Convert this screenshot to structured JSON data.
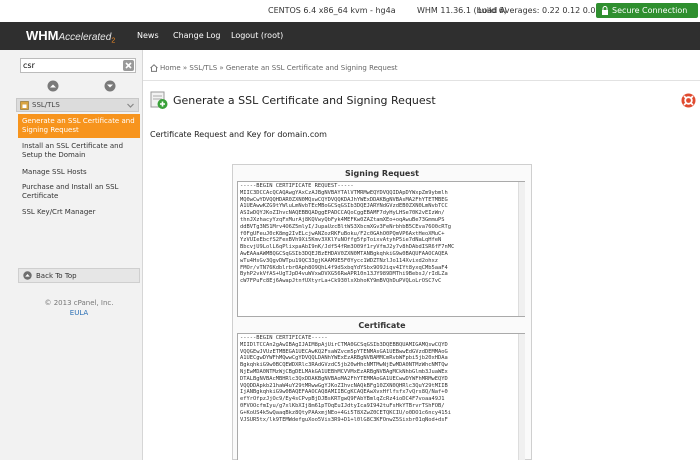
{
  "status": {
    "os": "CENTOS 6.4 x86_64 kvm - hg4a",
    "version": "WHM 11.36.1 (build 6)",
    "load": "Load Averages: 0.22 0.12 0.03",
    "secure": "Secure Connection"
  },
  "logo": {
    "primary": "WHM",
    "secondary": "Accelerated",
    "suffix": "2"
  },
  "nav": {
    "news": "News",
    "changelog": "Change Log",
    "logout": "Logout (root)"
  },
  "sidebar": {
    "search_value": "csr",
    "section": "SSL/TLS",
    "items": [
      {
        "label": "Generate an SSL Certificate and Signing Request",
        "active": true
      },
      {
        "label": "Install an SSL Certificate and Setup the Domain",
        "active": false
      },
      {
        "label": "Manage SSL Hosts",
        "active": false
      },
      {
        "label": "Purchase and Install an SSL Certificate",
        "active": false
      },
      {
        "label": "SSL Key/Crt Manager",
        "active": false
      }
    ],
    "back_to_top": "Back To Top",
    "copyright": "© 2013 cPanel, Inc.",
    "eula": "EULA"
  },
  "breadcrumb": "Home » SSL/TLS » Generate an SSL Certificate and Signing Request",
  "main": {
    "title": "Generate a SSL Certificate and Signing Request",
    "subtitle": "Certificate Request and Key for domain.com",
    "csr_heading": "Signing Request",
    "cert_heading": "Certificate",
    "csr_text": "-----BEGIN CERTIFICATE REQUEST-----\nMIIC3DCCAcQCAQAwgYAxCzAJBgNVBAYTAlVTMRMwEQYDVQQIDApDYWxpZm9ybmlh\nMQ0wCwYDVQQHDAR0ZXN0MQswCQYDVQQKDAJhYWExDDAKBgNVBAsMA2FhYTETMBEG\nA1UEAwwKZG9tYWluLmNvbTEcMBoGCSqGSIb3DQEJARYNdGVzdEB0ZXN0LmNvbTCC\nASIwDQYJKoZIhvcNAQEBBQADggEPADCCAQoCggEBAMF7dyHyLHSe70K2vEIzWn/\nthnJXzhacyYzqFxMurAj8KQVwyQbFyk4MEFKw0ZAZtamXEo+oqAwuBe73GmmuPS\nddBVTg3N51Mrv4O6Z5mlyI/JupaUzcBltWS3XbcmXGv3FeNrbhbB5CEva76O0cRTg\nf0FgUFeuJ0cK8mg2IvELcjwANZozRKFuBoku/F2c0GAhO0PQmVP6AxtHeoXMuC+\nYzVUIeEbcfS2FexBVh9Xi5Kmv3XKlYuNOffg5fpToixvAtyhP5ie7dNaLqHfeN\nBbcvjU9LolL6qPlixpaAbI9nK/Jdf54fRm3O09f1ryVfmJ2y7v8hDAbdISR6fF7nMC\nAwEAAaAWMBQGCSqGSIb3DQEJBzEHDAV0ZXN0MTANBgkqhkiG9w0BAQUFAAOCAQEA\nwTu4HsGv3QgvDWTpu19QC33gjKAAM9E5F0Yycc1WDZTNzlJo114Xvixd2ohxz\nFMOr/vTN76Kdblrbr0Aph8O9QhL4f9dSxbqYdYSbx9O9Jiqv4IYt8yxqCMb5aaF4\nByhP2vkVfAS+UgTJpD4vuWVxwDVXG56RwAPR10n13JY989DMThi9BebsJ/rIdLZa\ncW7FPuFc8Ej6AwapJtnfUXtyrLa+Ck930lxXbhoKY9mBVQhDuPVQLoLrOSC7vC",
    "cert_text": "-----BEGIN CERTIFICATE-----\nMIIDlTCCAn2gAwIBAgIJAIM8pAjUirCTMA0GCSqGSIb3DQEBBQUAMIGAMQswCQYD\nVQQGEwJVUzETMBEGA1UECAwKQ2FsaWZvcm5pYTENMAsGA1UEBwwEdGVzdDEMMAoG\nA1UECgwDYWFhMQwwCgYDVQQLDANhYWExEzARBgNVBAMMCmRvbWFpbi5jb20xHDAa\nBgkqhkiG9w0BCQEWDXRlc3RAdGVzdC5jb20wHhcNMTMwNjEwMDA0NTMzWhcNMTQw\nNjEwMDA0NTMzWjCBgDELMAkGA1UEBhMCVVMxEzARBgNVBAgMCkNhbGlmb3JuaWEx\nDTALBgNVBAcMBHRlc3QxDDAKBgNVBAoMA2FhYTEMMAoGA1UECwwDYWFhMRMwEQYD\nVQQDDApkb21haW4uY29tMRwwGgYJKoZIhvcNAQkBFg10ZXN0QHRlc3QuY29tMIIB\nIjANBgkqhkiG9w0BAQEFAAOCAQ8AMIIBCgKCAQEAwXvxHflfsfx7vQrs8Q/Naf+0\nefYrOfpzJjOc9/Ey4sCPvpBjDJBsKRTgwQ9FAbYBmlqZcRz4ioDC4F7voaa49J1\n0FVOOcfmIyu/g7xlKbXIj8m61pTOqEuIJdtyIca9I942tuFsHkYTBrvrTShFOB/\nG+KoUS4k5wQaaqBkz8QtyPAAxmjNEo+4Gi5T8XZwZ0CETQKCIU/o0DO1c6ncy415i\nVJSUR5tx/lk9TEMWdefguXoo5Vis3R9+D1+l0lG8C3KFOnwZ5Sixbr01qNod+dsF"
  }
}
